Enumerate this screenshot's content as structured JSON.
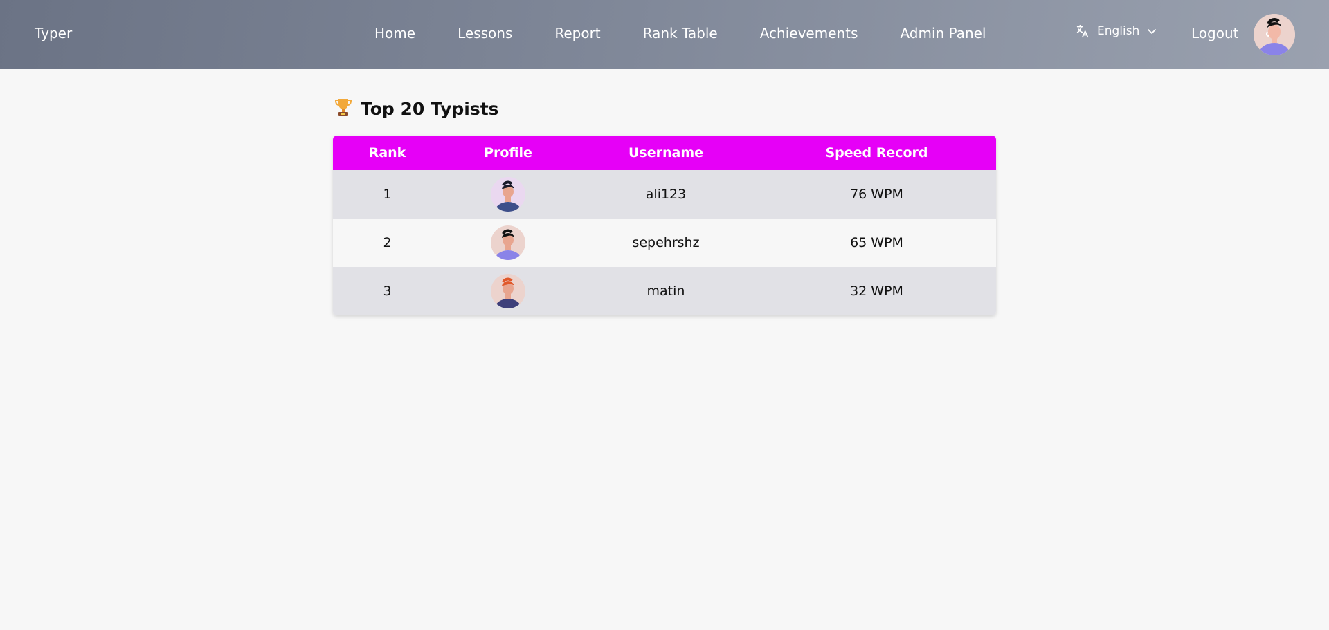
{
  "navbar": {
    "brand": "Typer",
    "links": [
      "Home",
      "Lessons",
      "Report",
      "Rank Table",
      "Achievements",
      "Admin Panel"
    ],
    "language": "English",
    "logout": "Logout",
    "accent": "#e600f7"
  },
  "main": {
    "title": "Top 20 Typists",
    "title_icon": "trophy-icon",
    "columns": [
      "Rank",
      "Profile",
      "Username",
      "Speed Record"
    ],
    "rows": [
      {
        "rank": "1",
        "username": "ali123",
        "speed": "76 WPM",
        "avatar_bg": "#ead8f0",
        "hair": "#1a1a2a",
        "shirt": "#3d4f8a"
      },
      {
        "rank": "2",
        "username": "sepehrshz",
        "speed": "65 WPM",
        "avatar_bg": "#ecd3cd",
        "hair": "#111111",
        "shirt": "#8a83e8"
      },
      {
        "rank": "3",
        "username": "matin",
        "speed": "32 WPM",
        "avatar_bg": "#ecd3cd",
        "hair": "#e0582a",
        "shirt": "#3d3f7a"
      }
    ]
  }
}
